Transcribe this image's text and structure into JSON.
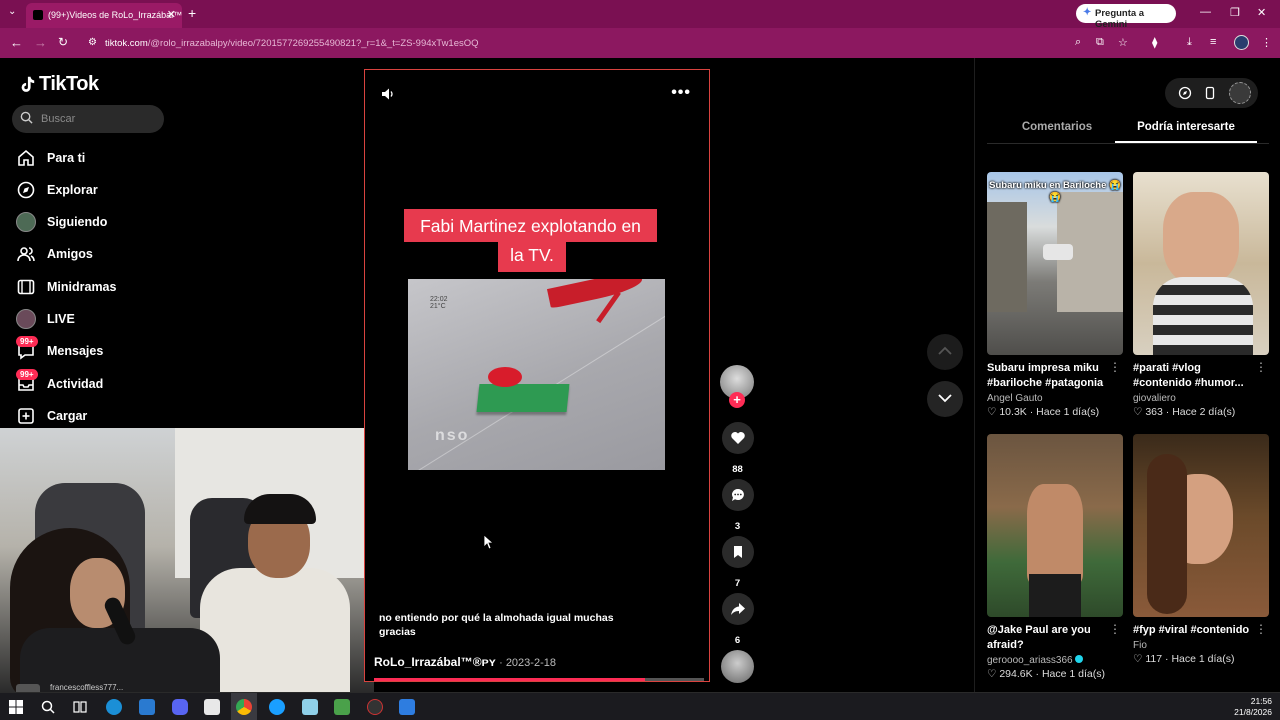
{
  "browser": {
    "tab_title": "(99+)Videos de RoLo_Irrazábal™...",
    "url_host": "tiktok.com",
    "url_path": "/@rolo_irrazabalpy/video/7201577269255490821?_r=1&_t=ZS-994xTw1esOQ",
    "gemini_label": "Pregunta a Gemini"
  },
  "sidebar": {
    "logo": "TikTok",
    "search_placeholder": "Buscar",
    "items": [
      {
        "label": "Para ti",
        "icon": "home-icon"
      },
      {
        "label": "Explorar",
        "icon": "compass-icon"
      },
      {
        "label": "Siguiendo",
        "icon": "avatar-icon"
      },
      {
        "label": "Amigos",
        "icon": "friends-icon"
      },
      {
        "label": "Minidramas",
        "icon": "film-icon"
      },
      {
        "label": "LIVE",
        "icon": "live-avatar-icon"
      },
      {
        "label": "Mensajes",
        "icon": "message-icon",
        "badge": "99+"
      },
      {
        "label": "Actividad",
        "icon": "inbox-icon",
        "badge": "99+"
      },
      {
        "label": "Cargar",
        "icon": "upload-icon"
      }
    ]
  },
  "webcam": {
    "caption": "francescoffless777..."
  },
  "video": {
    "caption_line1": "Fabi Martinez explotando en",
    "caption_line2": "la TV.",
    "clip_timestamp_line1": "22:02",
    "clip_timestamp_line2": "21°C",
    "clip_watermark": "nso",
    "description": "no entiendo por qué la almohada igual muchas gracias",
    "author": "RoLo_Irrazábal™®ᴘʏ",
    "date": "· 2023-2-18",
    "progress_percent": 82
  },
  "actions": {
    "likes": "88",
    "comments": "3",
    "saves": "7",
    "shares": "6"
  },
  "panel": {
    "tabs": [
      "Comentarios",
      "Podría interesarte"
    ],
    "active_tab": "Podría interesarte",
    "cards": [
      {
        "thumb_label": "Subaru miku en Bariloche 😭😭",
        "title": "Subaru impresa miku #bariloche #patagonia",
        "author": "Angel Gauto",
        "likes": "10.3K",
        "age": "Hace 1 día(s)"
      },
      {
        "thumb_label": "",
        "title": "#parati #vlog #contenido #humor...",
        "author": "giovaliero",
        "likes": "363",
        "age": "Hace 2 día(s)"
      },
      {
        "thumb_label": "",
        "title": "@Jake Paul are you afraid?",
        "author": "geroooo_ariass366",
        "likes": "294.6K",
        "age": "Hace 1 día(s)",
        "verified": true
      },
      {
        "thumb_label": "",
        "title": "#fyp #viral #contenido",
        "author": "Fio",
        "likes": "117",
        "age": "Hace 1 día(s)"
      }
    ]
  },
  "taskbar": {
    "time": "21:56",
    "date": "21/8/2026"
  },
  "colors": {
    "chrome_tab": "#7a1052",
    "accent": "#fe2c55",
    "caption_bg": "#e73a4e"
  }
}
